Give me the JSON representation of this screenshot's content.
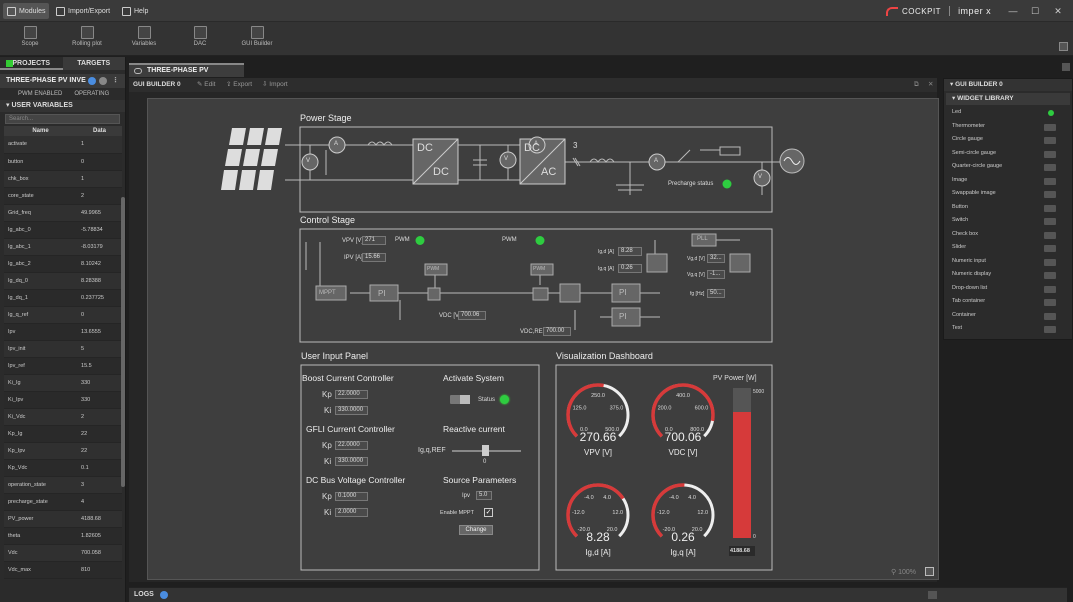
{
  "menu": {
    "modules": "Modules",
    "import_export": "Import/Export",
    "help": "Help"
  },
  "brand": {
    "cockpit": "COCKPIT",
    "imperix": "imper x"
  },
  "toolbar": [
    {
      "label": "Scope"
    },
    {
      "label": "Rolling plot"
    },
    {
      "label": "Variables"
    },
    {
      "label": "DAC"
    },
    {
      "label": "GUI Builder"
    }
  ],
  "left": {
    "tabs": [
      "PROJECTS",
      "TARGETS"
    ],
    "project": "THREE-PHASE PV INVE",
    "pwm_status": "PWM ENABLED",
    "op_status": "OPERATING",
    "section": "USER VARIABLES",
    "search_placeholder": "Search...",
    "col_name": "Name",
    "col_data": "Data",
    "vars": [
      {
        "n": "activate",
        "v": "1"
      },
      {
        "n": "button",
        "v": "0"
      },
      {
        "n": "chk_box",
        "v": "1"
      },
      {
        "n": "core_state",
        "v": "2"
      },
      {
        "n": "Grid_freq",
        "v": "49.9965"
      },
      {
        "n": "Ig_abc_0",
        "v": "-5.78834"
      },
      {
        "n": "Ig_abc_1",
        "v": "-8.03179"
      },
      {
        "n": "Ig_abc_2",
        "v": "8.10242"
      },
      {
        "n": "Ig_dq_0",
        "v": "8.28388"
      },
      {
        "n": "Ig_dq_1",
        "v": "0.237725"
      },
      {
        "n": "Ig_q_ref",
        "v": "0"
      },
      {
        "n": "Ipv",
        "v": "13.6555"
      },
      {
        "n": "Ipv_init",
        "v": "5"
      },
      {
        "n": "Ipv_ref",
        "v": "15.5"
      },
      {
        "n": "Ki_Ig",
        "v": "330"
      },
      {
        "n": "Ki_Ipv",
        "v": "330"
      },
      {
        "n": "Ki_Vdc",
        "v": "2"
      },
      {
        "n": "Kp_Ig",
        "v": "22"
      },
      {
        "n": "Kp_Ipv",
        "v": "22"
      },
      {
        "n": "Kp_Vdc",
        "v": "0.1"
      },
      {
        "n": "operation_state",
        "v": "3"
      },
      {
        "n": "precharge_state",
        "v": "4"
      },
      {
        "n": "PV_power",
        "v": "4188.68"
      },
      {
        "n": "theta",
        "v": "1.82605"
      },
      {
        "n": "Vdc",
        "v": "700.058"
      },
      {
        "n": "Vdc_max",
        "v": "810"
      }
    ]
  },
  "doc": {
    "tab": "THREE-PHASE PV INVERTER",
    "builder": "GUI BUILDER 0",
    "edit": "Edit",
    "export": "Export",
    "import": "Import",
    "zoom": "100%"
  },
  "power_stage": {
    "title": "Power Stage",
    "dcdc_top": "DC",
    "dcdc_bot": "DC",
    "dcac_top": "DC",
    "dcac_bot": "AC",
    "phases": "3",
    "precharge": "Precharge status",
    "sym_v": "V",
    "sym_a": "A"
  },
  "control_stage": {
    "title": "Control Stage",
    "vpv_label": "VPV [V]",
    "vpv": "271",
    "ipv_label": "IPV [A]",
    "ipv": "15.66",
    "pwm": "PWM",
    "pwm2": "PWM",
    "mppt": "MPPT",
    "pi": "PI",
    "pll": "PLL",
    "igd_label": "Ig,d [A]",
    "igd": "8.28",
    "igq_label": "Ig,q [A]",
    "igq": "0.26",
    "vgd_label": "Vg,d [V]",
    "vgd": "32...",
    "vgq_label": "Vg,q [V]",
    "vgq": "-1...",
    "fg_label": "fg [Hz]",
    "fg": "50...",
    "vdc_label": "VDC [V]",
    "vdc": "700.06",
    "vdcref_label": "VDC,REF",
    "vdcref": "700.00"
  },
  "input_panel": {
    "title": "User Input Panel",
    "boost": "Boost Current Controller",
    "boost_kp": "22.0000",
    "boost_ki": "330.0000",
    "gfli": "GFLI Current Controller",
    "gfli_kp": "22.0000",
    "gfli_ki": "330.0000",
    "dcbus": "DC Bus Voltage Controller",
    "dc_kp": "0.1000",
    "dc_ki": "2.0000",
    "kp": "Kp",
    "ki": "Ki",
    "activate": "Activate System",
    "status": "Status",
    "reactive": "Reactive current",
    "igq_ref": "Ig,q,REF",
    "slider_val": "0",
    "source": "Source Parameters",
    "ipv_label": "Ipv",
    "ipv_val": "5.0",
    "mppt": "Enable MPPT",
    "change": "Change"
  },
  "dashboard": {
    "title": "Visualization Dashboard",
    "g1": {
      "value": "270.66",
      "label": "VPV [V]",
      "ticks": [
        "0.0",
        "125.0",
        "250.0",
        "375.0",
        "500.0"
      ]
    },
    "g2": {
      "value": "700.06",
      "label": "VDC [V]",
      "ticks": [
        "0.0",
        "200.0",
        "400.0",
        "600.0",
        "800.0"
      ]
    },
    "g3": {
      "value": "8.28",
      "label": "Ig,d [A]",
      "ticks": [
        "-20.0",
        "-12.0",
        "-4.0",
        "4.0",
        "12.0",
        "20.0"
      ]
    },
    "g4": {
      "value": "0.26",
      "label": "Ig,q [A]",
      "ticks": [
        "-20.0",
        "-12.0",
        "-4.0",
        "4.0",
        "12.0",
        "20.0"
      ]
    },
    "pv": {
      "title": "PV Power [W]",
      "max": "5000",
      "min": "0",
      "value": "4188.68",
      "fraction": 0.84
    }
  },
  "right": {
    "header": "GUI BUILDER 0",
    "library": "WIDGET LIBRARY",
    "widgets": [
      "Led",
      "Thermometer",
      "Circle gauge",
      "Semi-circle gauge",
      "Quarter-circle gauge",
      "Image",
      "Swappable image",
      "Button",
      "Switch",
      "Check box",
      "Slider",
      "Numeric input",
      "Numeric display",
      "Drop-down list",
      "Tab container",
      "Container",
      "Text"
    ]
  },
  "logs": "LOGS"
}
